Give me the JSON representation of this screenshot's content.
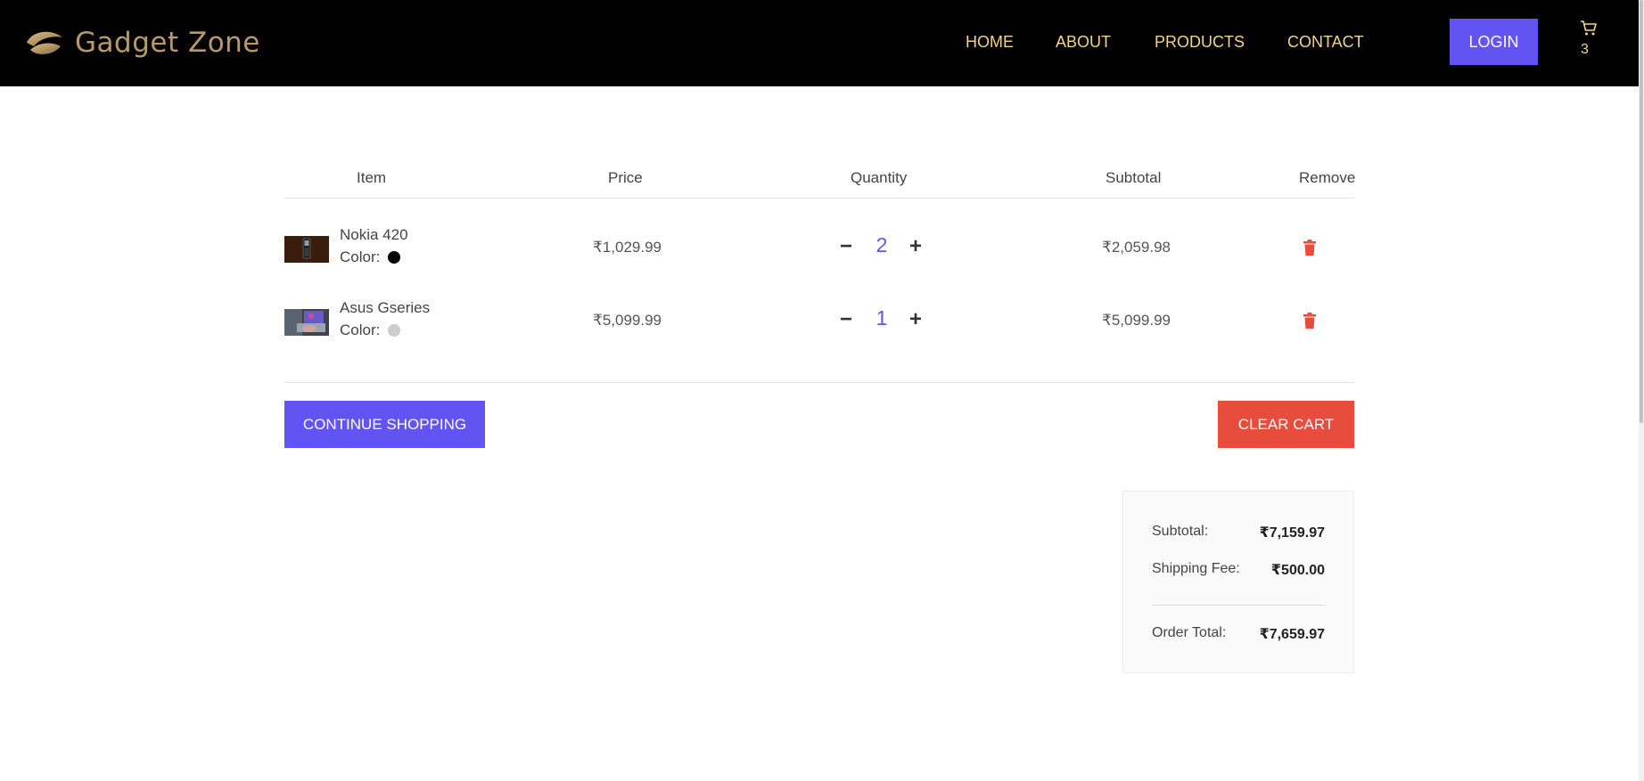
{
  "brand": {
    "name": "Gadget Zone",
    "logo_icon": "leaf-icon",
    "colors": {
      "gold": "#b89a68",
      "nav_text": "#f1d48a",
      "accent": "#6254f3",
      "danger": "#e74c3c"
    }
  },
  "nav": {
    "home": "HOME",
    "about": "ABOUT",
    "products": "PRODUCTS",
    "contact": "CONTACT",
    "login": "LOGIN"
  },
  "cart_badge": {
    "icon": "cart-icon",
    "count": "3"
  },
  "table": {
    "headers": {
      "item": "Item",
      "price": "Price",
      "quantity": "Quantity",
      "subtotal": "Subtotal",
      "remove": "Remove"
    },
    "color_label": "Color:",
    "rows": [
      {
        "name": "Nokia 420",
        "color": "#000000",
        "price": "₹1,029.99",
        "quantity": "2",
        "subtotal": "₹2,059.98"
      },
      {
        "name": "Asus Gseries",
        "color": "#cccccc",
        "price": "₹5,099.99",
        "quantity": "1",
        "subtotal": "₹5,099.99"
      }
    ]
  },
  "actions": {
    "continue_shopping": "CONTINUE SHOPPING",
    "clear_cart": "CLEAR CART"
  },
  "summary": {
    "subtotal_label": "Subtotal:",
    "subtotal": "₹7,159.97",
    "shipping_label": "Shipping Fee:",
    "shipping": "₹500.00",
    "total_label": "Order Total:",
    "total": "₹7,659.97"
  }
}
